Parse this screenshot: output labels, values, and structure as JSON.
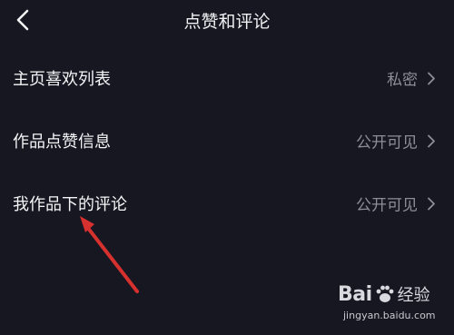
{
  "header": {
    "title": "点赞和评论",
    "back_icon": "chevron-left-icon"
  },
  "settings": [
    {
      "label": "主页喜欢列表",
      "value": "私密"
    },
    {
      "label": "作品点赞信息",
      "value": "公开可见"
    },
    {
      "label": "我作品下的评论",
      "value": "公开可见"
    }
  ],
  "annotation": {
    "arrow_color": "#d6312e"
  },
  "watermark": {
    "brand": "Bai",
    "suffix": "经验",
    "url": "jingyan.baidu.com"
  }
}
